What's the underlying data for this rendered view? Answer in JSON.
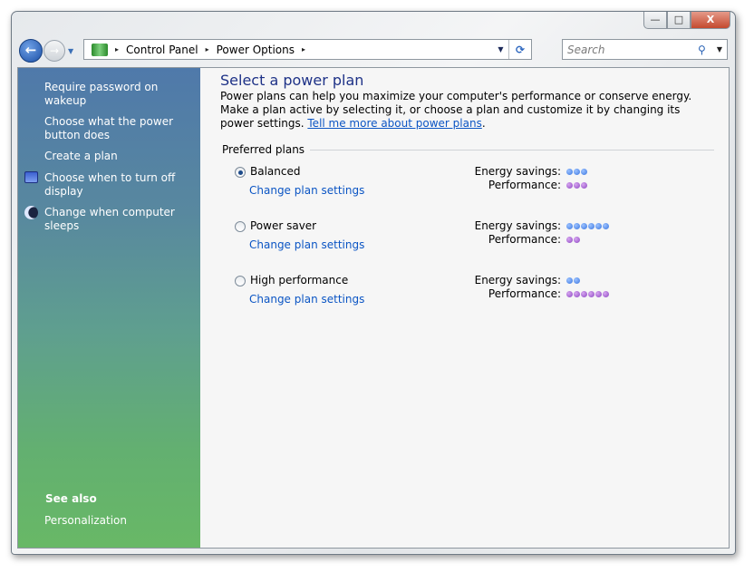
{
  "window": {
    "minimize": "—",
    "maximize": "□",
    "close": "X"
  },
  "nav": {
    "back": "←",
    "forward": "→",
    "dropdown": "▼"
  },
  "address": {
    "crumbs": [
      "Control Panel",
      "Power Options"
    ],
    "sep": "▸",
    "dropdown": "▼",
    "refresh": "⟳"
  },
  "search": {
    "placeholder": "Search",
    "icon": "⚲",
    "dropdown": "▼"
  },
  "sidebar": {
    "items": [
      {
        "label": "Require password on wakeup"
      },
      {
        "label": "Choose what the power button does"
      },
      {
        "label": "Create a plan"
      },
      {
        "label": "Choose when to turn off display",
        "icon": "display-clock-icon"
      },
      {
        "label": "Change when computer sleeps",
        "icon": "moon-icon"
      }
    ],
    "see_also": "See also",
    "links": [
      "Personalization"
    ]
  },
  "main": {
    "title": "Select a power plan",
    "description": "Power plans can help you maximize your computer's performance or conserve energy. Make a plan active by selecting it, or choose a plan and customize it by changing its power settings. ",
    "link": "Tell me more about power plans",
    "period": ".",
    "group": "Preferred plans",
    "energy_label": "Energy savings:",
    "perf_label": "Performance:",
    "change_label": "Change plan settings",
    "plans": [
      {
        "name": "Balanced",
        "selected": true,
        "energy": 3,
        "performance": 3
      },
      {
        "name": "Power saver",
        "selected": false,
        "energy": 6,
        "performance": 2
      },
      {
        "name": "High performance",
        "selected": false,
        "energy": 2,
        "performance": 6
      }
    ]
  },
  "colors": {
    "energy": "#3a76e0",
    "performance": "#8d47c2"
  }
}
